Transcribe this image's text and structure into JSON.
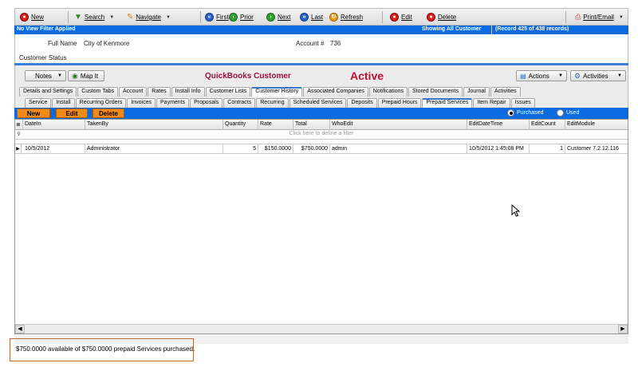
{
  "toolbar": {
    "new": "New",
    "search": "Search",
    "navigate": "Navigate",
    "first": "First",
    "prior": "Prior",
    "next": "Next",
    "last": "Last",
    "refresh": "Refresh",
    "edit": "Edit",
    "delete": "Delete",
    "print_email": "Print/Email"
  },
  "filterbar": {
    "filter_status": "No View Filter Applied",
    "showing": "Showing All Customer",
    "record": "(Record 425 of 438 records)"
  },
  "customer": {
    "full_name_label": "Full Name",
    "full_name": "City of Kenmore",
    "account_label": "Account #",
    "account": "736",
    "status_label": "Customer Status"
  },
  "panel": {
    "notes": "Notes",
    "map_it": "Map It",
    "title": "QuickBooks Customer",
    "state": "Active",
    "actions": "Actions",
    "activities": "Activities"
  },
  "tabs_row1": [
    "Details and Settings",
    "Custom Tabs",
    "Account",
    "Rates",
    "Install Info",
    "Customer Lists",
    "Customer History",
    "Associated Companies",
    "Notifications",
    "Stored Documents",
    "Journal",
    "Activities"
  ],
  "tabs_row2": [
    "Service",
    "Install",
    "Recurring Orders",
    "Invoices",
    "Payments",
    "Proposals",
    "Contracts",
    "Recurring",
    "Scheduled Services",
    "Deposits",
    "Prepaid Hours",
    "Prepaid Services",
    "Item Repair",
    "Issues"
  ],
  "actions": {
    "new": "New",
    "edit": "Edit",
    "delete": "Delete",
    "purchased": "Purchased",
    "used": "Used"
  },
  "grid": {
    "columns": [
      "DateIn",
      "TakenBy",
      "Quantity",
      "Rate",
      "Total",
      "WhoEdit",
      "EditDateTime",
      "EditCount",
      "EditModule"
    ],
    "filter_hint": "Click here to define a filter",
    "rows": [
      [
        "10/5/2012",
        "Administrator",
        "5",
        "$150.0000",
        "$750.0000",
        "admin",
        "10/5/2012 1:45:08 PM",
        "1",
        "Customer 7.2.12.116"
      ]
    ]
  },
  "status": {
    "text": "$750.0000 available of $750.0000 prepaid Services purchased."
  }
}
